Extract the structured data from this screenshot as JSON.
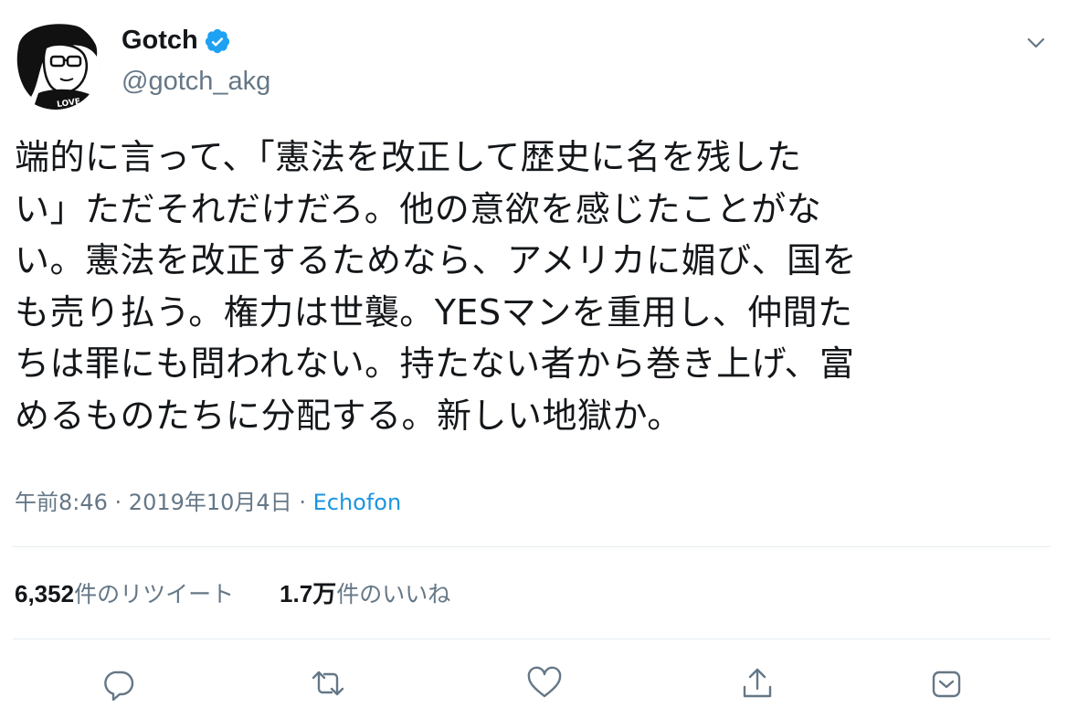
{
  "author": {
    "display_name": "Gotch",
    "handle": "@gotch_akg",
    "avatar_text": "LOVE"
  },
  "tweet": {
    "lines": [
      "端的に言って、「憲法を改正して歴史に名を残した",
      "い」ただそれだけだろ。他の意欲を感じたことがな",
      "い。憲法を改正するためなら、アメリカに媚び、国を",
      "も売り払う。権力は世襲。YESマンを重用し、仲間た",
      "ちは罪にも問われない。持たない者から巻き上げ、富",
      "めるものたちに分配する。新しい地獄か。"
    ]
  },
  "meta": {
    "time": "午前8:46",
    "separator": " · ",
    "date": "2019年10月4日",
    "source": "Echofon"
  },
  "stats": {
    "retweet_count": "6,352",
    "retweet_label": "件のリツイート",
    "like_count": "1.7万",
    "like_label": "件のいいね"
  },
  "icons": {
    "verified": "verified-badge-icon",
    "caret": "chevron-down-icon",
    "reply": "reply-icon",
    "retweet": "retweet-icon",
    "like": "heart-icon",
    "share": "share-icon",
    "bookmark": "bookmark-icon"
  },
  "colors": {
    "text": "#14171a",
    "secondary": "#657786",
    "link": "#1b95e0",
    "verified": "#1da1f2",
    "divider": "#e6ecf0"
  }
}
